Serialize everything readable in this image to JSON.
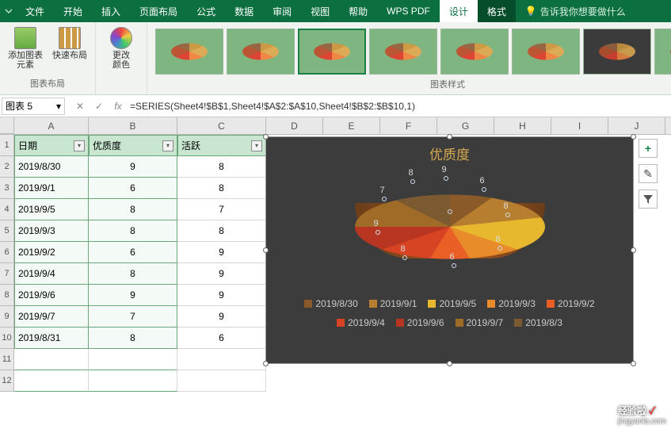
{
  "tabs": {
    "file": "文件",
    "start": "开始",
    "insert": "插入",
    "layout": "页面布局",
    "formula": "公式",
    "data": "数据",
    "review": "审阅",
    "view": "视图",
    "help": "帮助",
    "wps": "WPS PDF",
    "design": "设计",
    "format": "格式",
    "tell": "告诉我你想要做什么"
  },
  "ribbon": {
    "add_element": "添加图表\n元素",
    "quick_layout": "快速布局",
    "change_color": "更改\n颜色",
    "group_layout": "图表布局",
    "group_styles": "图表样式"
  },
  "namebox": {
    "name": "图表 5",
    "fx": "fx",
    "formula": "=SERIES(Sheet4!$B$1,Sheet4!$A$2:$A$10,Sheet4!$B$2:$B$10,1)"
  },
  "cols": [
    "A",
    "B",
    "C",
    "D",
    "E",
    "F",
    "G",
    "H",
    "I",
    "J"
  ],
  "headers": {
    "date": "日期",
    "quality": "优质度",
    "active": "活跃"
  },
  "rows": [
    {
      "d": "2019/8/30",
      "q": "9",
      "a": "8"
    },
    {
      "d": "2019/9/1",
      "q": "6",
      "a": "8"
    },
    {
      "d": "2019/9/5",
      "q": "8",
      "a": "7"
    },
    {
      "d": "2019/9/3",
      "q": "8",
      "a": "8"
    },
    {
      "d": "2019/9/2",
      "q": "6",
      "a": "9"
    },
    {
      "d": "2019/9/4",
      "q": "8",
      "a": "9"
    },
    {
      "d": "2019/9/6",
      "q": "9",
      "a": "9"
    },
    {
      "d": "2019/9/7",
      "q": "7",
      "a": "9"
    },
    {
      "d": "2019/8/31",
      "q": "8",
      "a": "6"
    }
  ],
  "chart_data": {
    "type": "pie",
    "title": "优质度",
    "categories": [
      "2019/8/30",
      "2019/9/1",
      "2019/9/5",
      "2019/9/3",
      "2019/9/2",
      "2019/9/4",
      "2019/9/6",
      "2019/9/7",
      "2019/8/3"
    ],
    "values": [
      9,
      6,
      8,
      8,
      6,
      8,
      9,
      7,
      8
    ],
    "colors": [
      "#8a5a28",
      "#b87e2f",
      "#e7b82d",
      "#e78b2b",
      "#e95f25",
      "#d74423",
      "#b83621",
      "#a06a27",
      "#7b5a32"
    ]
  },
  "watermark": {
    "brand": "经验啦",
    "url": "jingyanla.com"
  },
  "side": {
    "plus": "+",
    "brush": "✎",
    "filter": "▾"
  }
}
